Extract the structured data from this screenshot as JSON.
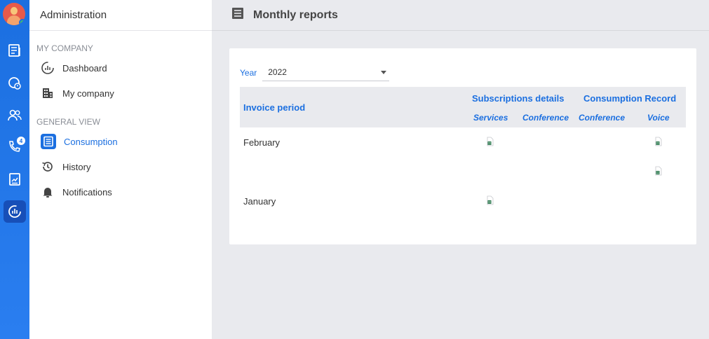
{
  "sidebar": {
    "title": "Administration",
    "sections": [
      {
        "label": "MY COMPANY"
      },
      {
        "label": "GENERAL VIEW"
      }
    ],
    "items": [
      {
        "label": "Dashboard",
        "icon": "dashboard-gauge-icon"
      },
      {
        "label": "My company",
        "icon": "building-icon"
      },
      {
        "label": "Consumption",
        "icon": "list-document-icon",
        "active": true
      },
      {
        "label": "History",
        "icon": "history-clock-icon"
      },
      {
        "label": "Notifications",
        "icon": "bell-icon"
      }
    ]
  },
  "rail": {
    "badge_count": "4",
    "accent": "#1b6fe0"
  },
  "header": {
    "title": "Monthly reports",
    "icon": "report-list-icon"
  },
  "filter": {
    "year_label": "Year",
    "year_value": "2022"
  },
  "table": {
    "col_invoice": "Invoice period",
    "group_subscriptions": "Subscriptions details",
    "group_consumption": "Consumption Record",
    "sub_services": "Services",
    "sub_conference_a": "Conference",
    "sub_conference_b": "Conference",
    "sub_voice": "Voice",
    "rows": [
      {
        "period": "February"
      },
      {
        "period": ""
      },
      {
        "period": "January"
      }
    ]
  }
}
